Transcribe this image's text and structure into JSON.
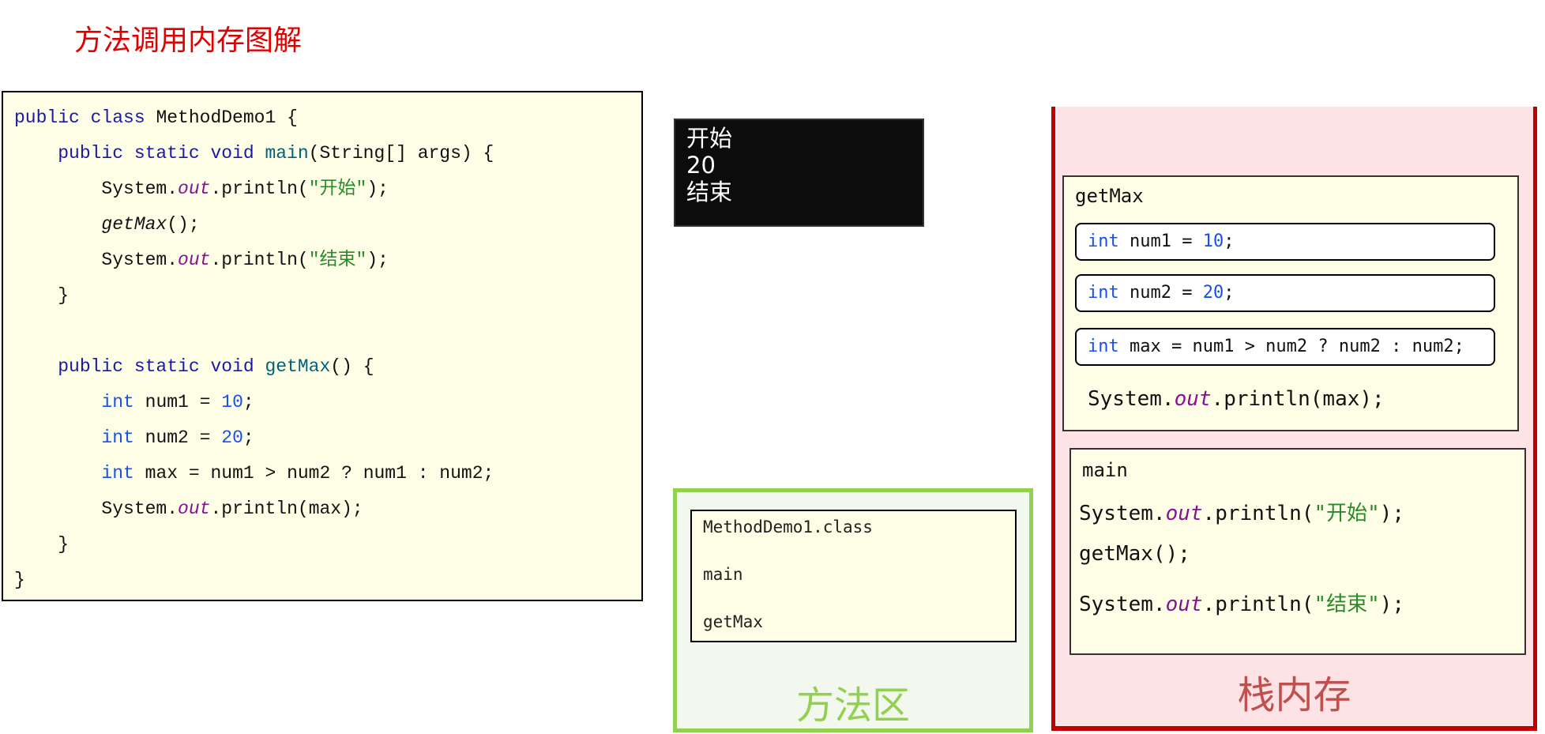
{
  "title": "方法调用内存图解",
  "colors": {
    "title": "#e00000",
    "keyword": "#1a1aa6",
    "method": "#00627a",
    "field": "#871094",
    "string": "#2a8a2a",
    "number": "#1750eb",
    "code_bg": "#fefee6",
    "method_area_border": "#92d050",
    "stack_border": "#c00000",
    "stack_bg": "#fde3e5"
  },
  "code": {
    "lines": [
      [
        {
          "t": "public class ",
          "s": "kw"
        },
        {
          "t": "MethodDemo1 {",
          "s": ""
        }
      ],
      [
        {
          "t": "    public static void ",
          "s": "kw"
        },
        {
          "t": "main",
          "s": "fn"
        },
        {
          "t": "(String[] args) {",
          "s": ""
        }
      ],
      [
        {
          "t": "        System.",
          "s": ""
        },
        {
          "t": "out",
          "s": "out"
        },
        {
          "t": ".println(",
          "s": ""
        },
        {
          "t": "\"开始\"",
          "s": "str"
        },
        {
          "t": ");",
          "s": ""
        }
      ],
      [
        {
          "t": "        ",
          "s": ""
        },
        {
          "t": "getMax",
          "s": "it"
        },
        {
          "t": "();",
          "s": ""
        }
      ],
      [
        {
          "t": "        System.",
          "s": ""
        },
        {
          "t": "out",
          "s": "out"
        },
        {
          "t": ".println(",
          "s": ""
        },
        {
          "t": "\"结束\"",
          "s": "str"
        },
        {
          "t": ");",
          "s": ""
        }
      ],
      [
        {
          "t": "    }",
          "s": ""
        }
      ],
      [],
      [
        {
          "t": "    public static void ",
          "s": "kw"
        },
        {
          "t": "getMax",
          "s": "fn"
        },
        {
          "t": "() {",
          "s": ""
        }
      ],
      [
        {
          "t": "        ",
          "s": ""
        },
        {
          "t": "int",
          "s": "num"
        },
        {
          "t": " num1 = ",
          "s": ""
        },
        {
          "t": "10",
          "s": "num"
        },
        {
          "t": ";",
          "s": ""
        }
      ],
      [
        {
          "t": "        ",
          "s": ""
        },
        {
          "t": "int",
          "s": "num"
        },
        {
          "t": " num2 = ",
          "s": ""
        },
        {
          "t": "20",
          "s": "num"
        },
        {
          "t": ";",
          "s": ""
        }
      ],
      [
        {
          "t": "        ",
          "s": ""
        },
        {
          "t": "int",
          "s": "num"
        },
        {
          "t": " max = num1 > num2 ? num1 : num2;",
          "s": ""
        }
      ],
      [
        {
          "t": "        System.",
          "s": ""
        },
        {
          "t": "out",
          "s": "out"
        },
        {
          "t": ".println(max);",
          "s": ""
        }
      ],
      [
        {
          "t": "    }",
          "s": ""
        }
      ],
      [
        {
          "t": "}",
          "s": ""
        }
      ]
    ]
  },
  "console": {
    "lines": [
      "开始",
      "20",
      "结束"
    ]
  },
  "method_area": {
    "label": "方法区",
    "class_box": {
      "items": [
        "MethodDemo1.class",
        "main",
        "getMax"
      ]
    }
  },
  "stack": {
    "label": "栈内存",
    "frames": {
      "getMax": {
        "name": "getMax",
        "vars": [
          [
            {
              "t": "int",
              "s": "num"
            },
            {
              "t": " num1 = ",
              "s": ""
            },
            {
              "t": "10",
              "s": "num"
            },
            {
              "t": ";",
              "s": ""
            }
          ],
          [
            {
              "t": "int",
              "s": "num"
            },
            {
              "t": " num2 = ",
              "s": ""
            },
            {
              "t": "20",
              "s": "num"
            },
            {
              "t": ";",
              "s": ""
            }
          ],
          [
            {
              "t": "int",
              "s": "num"
            },
            {
              "t": " max = num1 > num2 ? num2 : num2;",
              "s": ""
            }
          ]
        ],
        "print": [
          {
            "t": "System.",
            "s": ""
          },
          {
            "t": "out",
            "s": "out"
          },
          {
            "t": ".println(max);",
            "s": ""
          }
        ]
      },
      "main": {
        "name": "main",
        "lines": [
          [
            {
              "t": "System.",
              "s": ""
            },
            {
              "t": "out",
              "s": "out"
            },
            {
              "t": ".println(",
              "s": ""
            },
            {
              "t": "\"开始\"",
              "s": "str"
            },
            {
              "t": ");",
              "s": ""
            }
          ],
          [
            {
              "t": "getMax();",
              "s": ""
            }
          ],
          [
            {
              "t": "System.",
              "s": ""
            },
            {
              "t": "out",
              "s": "out"
            },
            {
              "t": ".println(",
              "s": ""
            },
            {
              "t": "\"结束\"",
              "s": "str"
            },
            {
              "t": ");",
              "s": ""
            }
          ]
        ]
      }
    }
  }
}
